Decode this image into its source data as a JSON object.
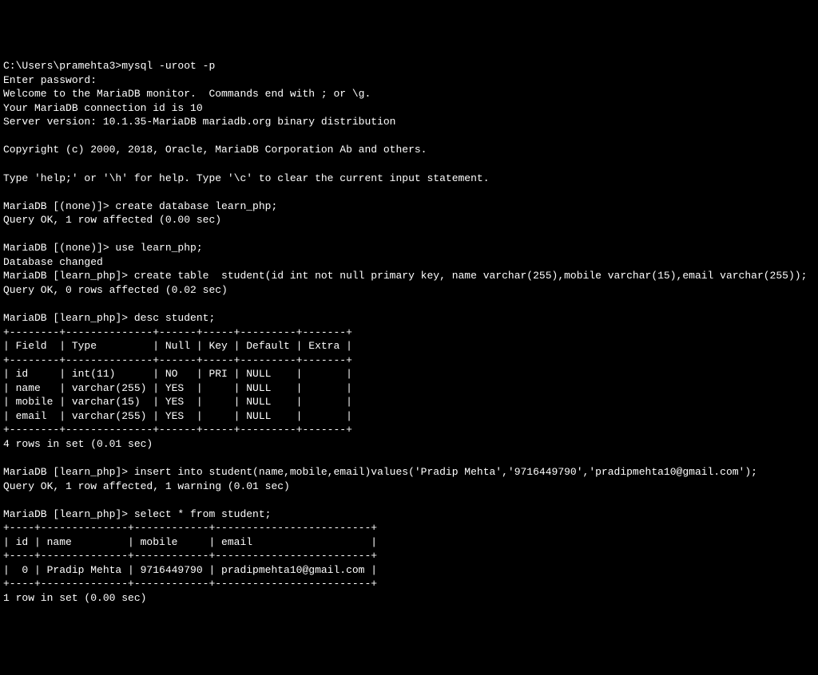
{
  "lines": {
    "l1": "C:\\Users\\pramehta3>mysql -uroot -p",
    "l2": "Enter password:",
    "l3": "Welcome to the MariaDB monitor.  Commands end with ; or \\g.",
    "l4": "Your MariaDB connection id is 10",
    "l5": "Server version: 10.1.35-MariaDB mariadb.org binary distribution",
    "l6": "",
    "l7": "Copyright (c) 2000, 2018, Oracle, MariaDB Corporation Ab and others.",
    "l8": "",
    "l9": "Type 'help;' or '\\h' for help. Type '\\c' to clear the current input statement.",
    "l10": "",
    "l11": "MariaDB [(none)]> create database learn_php;",
    "l12": "Query OK, 1 row affected (0.00 sec)",
    "l13": "",
    "l14": "MariaDB [(none)]> use learn_php;",
    "l15": "Database changed",
    "l16": "MariaDB [learn_php]> create table  student(id int not null primary key, name varchar(255),mobile varchar(15),email varchar(255));",
    "l17": "Query OK, 0 rows affected (0.02 sec)",
    "l18": "",
    "l19": "MariaDB [learn_php]> desc student;",
    "l20": "+--------+--------------+------+-----+---------+-------+",
    "l21": "| Field  | Type         | Null | Key | Default | Extra |",
    "l22": "+--------+--------------+------+-----+---------+-------+",
    "l23": "| id     | int(11)      | NO   | PRI | NULL    |       |",
    "l24": "| name   | varchar(255) | YES  |     | NULL    |       |",
    "l25": "| mobile | varchar(15)  | YES  |     | NULL    |       |",
    "l26": "| email  | varchar(255) | YES  |     | NULL    |       |",
    "l27": "+--------+--------------+------+-----+---------+-------+",
    "l28": "4 rows in set (0.01 sec)",
    "l29": "",
    "l30": "MariaDB [learn_php]> insert into student(name,mobile,email)values('Pradip Mehta','9716449790','pradipmehta10@gmail.com');",
    "l31": "Query OK, 1 row affected, 1 warning (0.01 sec)",
    "l32": "",
    "l33": "MariaDB [learn_php]> select * from student;",
    "l34": "+----+--------------+------------+-------------------------+",
    "l35": "| id | name         | mobile     | email                   |",
    "l36": "+----+--------------+------------+-------------------------+",
    "l37": "|  0 | Pradip Mehta | 9716449790 | pradipmehta10@gmail.com |",
    "l38": "+----+--------------+------------+-------------------------+",
    "l39": "1 row in set (0.00 sec)"
  }
}
